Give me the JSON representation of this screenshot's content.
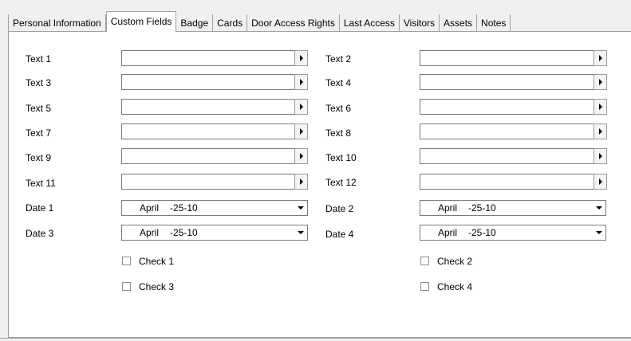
{
  "tabs": [
    {
      "label": "Personal Information",
      "active": false
    },
    {
      "label": "Custom Fields",
      "active": true
    },
    {
      "label": "Badge",
      "active": false
    },
    {
      "label": "Cards",
      "active": false
    },
    {
      "label": "Door Access Rights",
      "active": false
    },
    {
      "label": "Last Access",
      "active": false
    },
    {
      "label": "Visitors",
      "active": false
    },
    {
      "label": "Assets",
      "active": false
    },
    {
      "label": "Notes",
      "active": false
    }
  ],
  "text_fields": [
    {
      "label": "Text 1",
      "value": ""
    },
    {
      "label": "Text 2",
      "value": ""
    },
    {
      "label": "Text 3",
      "value": ""
    },
    {
      "label": "Text 4",
      "value": ""
    },
    {
      "label": "Text 5",
      "value": ""
    },
    {
      "label": "Text 6",
      "value": ""
    },
    {
      "label": "Text 7",
      "value": ""
    },
    {
      "label": "Text 8",
      "value": ""
    },
    {
      "label": "Text 9",
      "value": ""
    },
    {
      "label": "Text 10",
      "value": ""
    },
    {
      "label": "Text 11",
      "value": ""
    },
    {
      "label": "Text 12",
      "value": ""
    }
  ],
  "date_fields": [
    {
      "label": "Date 1",
      "month": "April",
      "day_year": "-25-10"
    },
    {
      "label": "Date 2",
      "month": "April",
      "day_year": "-25-10"
    },
    {
      "label": "Date 3",
      "month": "April",
      "day_year": "-25-10"
    },
    {
      "label": "Date 4",
      "month": "April",
      "day_year": "-25-10"
    }
  ],
  "checkboxes": [
    {
      "label": "Check 1",
      "checked": false
    },
    {
      "label": "Check 2",
      "checked": false
    },
    {
      "label": "Check 3",
      "checked": false
    },
    {
      "label": "Check 4",
      "checked": false
    }
  ],
  "icons": {
    "field_expand": "triangle-right-arrow-icon",
    "date_dropdown": "triangle-down-arrow-icon"
  }
}
